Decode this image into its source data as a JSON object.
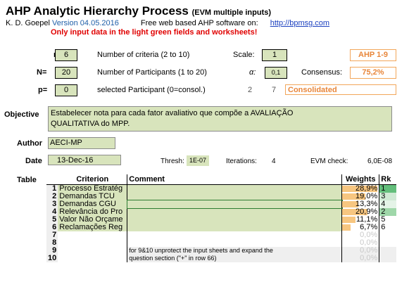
{
  "header": {
    "title": "AHP Analytic Hierarchy Process",
    "title_suffix": "(EVM multiple inputs)",
    "author": "K. D. Goepel",
    "version": "Version 04.05.2016",
    "tagline": "Free web based AHP software on:",
    "url": "http://bpmsg.com",
    "warning": "Only input data in the light green fields and worksheets!"
  },
  "params": {
    "n_label": "n=",
    "n_value": "6",
    "n_desc": "Number of criteria (2 to 10)",
    "scale_label": "Scale:",
    "scale_value": "1",
    "scale_name": "AHP 1-9",
    "N_label": "N=",
    "N_value": "20",
    "N_desc": "Number of Participants (1 to 20)",
    "alpha_label": "α:",
    "alpha_value": "0,1",
    "consensus_label": "Consensus:",
    "consensus_value": "75,2%",
    "p_label": "p=",
    "p_value": "0",
    "p_desc": "selected Participant (0=consol.)",
    "p_num1": "2",
    "p_num2": "7",
    "p_status": "Consolidated"
  },
  "objective": {
    "label": "Objective",
    "text_line1": "Estabelecer nota para cada fator avaliativo que compõe a AVALIAÇÃO",
    "text_line2": "QUALITATIVA do MPP."
  },
  "meta": {
    "author_label": "Author",
    "author_value": "AECI-MP",
    "date_label": "Date",
    "date_value": "13-Dec-16",
    "thresh_label": "Thresh:",
    "thresh_value": "1E-07",
    "iter_label": "Iterations:",
    "iter_value": "4",
    "evm_label": "EVM check:",
    "evm_value": "6,0E-08"
  },
  "table": {
    "label": "Table",
    "headers": {
      "criterion": "Criterion",
      "comment": "Comment",
      "weights": "Weights",
      "rank": "Rk"
    },
    "rows": [
      {
        "n": "1",
        "criterion": "Processo Estratég",
        "comment": "",
        "weight": "28,9%",
        "w": 28.9,
        "rank": "1"
      },
      {
        "n": "2",
        "criterion": "Demandas TCU",
        "comment": "",
        "weight": "19,0%",
        "w": 19.0,
        "rank": "3"
      },
      {
        "n": "3",
        "criterion": "Demandas CGU",
        "comment": "",
        "weight": "13,3%",
        "w": 13.3,
        "rank": "4"
      },
      {
        "n": "4",
        "criterion": "Relevância do Pro",
        "comment": "",
        "weight": "20,9%",
        "w": 20.9,
        "rank": "2"
      },
      {
        "n": "5",
        "criterion": "Valor Não Orçame",
        "comment": "",
        "weight": "11,1%",
        "w": 11.1,
        "rank": "5"
      },
      {
        "n": "6",
        "criterion": "Reclamações Reg",
        "comment": "",
        "weight": "6,7%",
        "w": 6.7,
        "rank": "6"
      },
      {
        "n": "7",
        "criterion": "",
        "comment": "",
        "weight": "0,0%",
        "w": 0,
        "rank": ""
      },
      {
        "n": "8",
        "criterion": "",
        "comment": "",
        "weight": "0,0%",
        "w": 0,
        "rank": ""
      },
      {
        "n": "9",
        "criterion": "",
        "comment": "for 9&10 unprotect the input sheets and expand the",
        "weight": "0,0%",
        "w": 0,
        "rank": ""
      },
      {
        "n": "10",
        "criterion": "",
        "comment": "question section (\"+\" in row 66)",
        "weight": "0,0%",
        "w": 0,
        "rank": ""
      }
    ]
  }
}
